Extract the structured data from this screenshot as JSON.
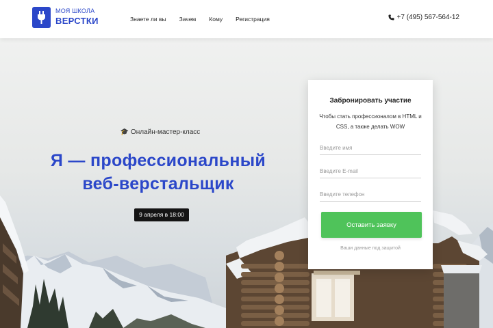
{
  "brand": {
    "line1": "МОЯ ШКОЛА",
    "line2": "ВЕРСТКИ",
    "accent": "#2b47c9",
    "icon": "plug-icon"
  },
  "nav": [
    {
      "label": "Знаете ли вы"
    },
    {
      "label": "Зачем"
    },
    {
      "label": "Кому"
    },
    {
      "label": "Регистрация"
    }
  ],
  "contact": {
    "phone": "+7 (495) 567-564-12",
    "icon": "phone-icon"
  },
  "hero": {
    "subtitle": "Онлайн-мастер-класс",
    "subtitle_icon": "graduation-cap-icon",
    "headline_line1": "Я — профессиональный",
    "headline_line2": "веб-верстальщик",
    "date": "9 апреля в 18:00"
  },
  "form": {
    "title": "Забронировать участие",
    "description": "Чтобы стать профессионалом в HTML и CSS, а также делать WOW",
    "name_placeholder": "Введите имя",
    "email_placeholder": "Введите E-mail",
    "phone_placeholder": "Введите телефон",
    "submit_label": "Оставить заявку",
    "submit_color": "#4fc35a",
    "privacy": "Ваши данные под защитой"
  }
}
